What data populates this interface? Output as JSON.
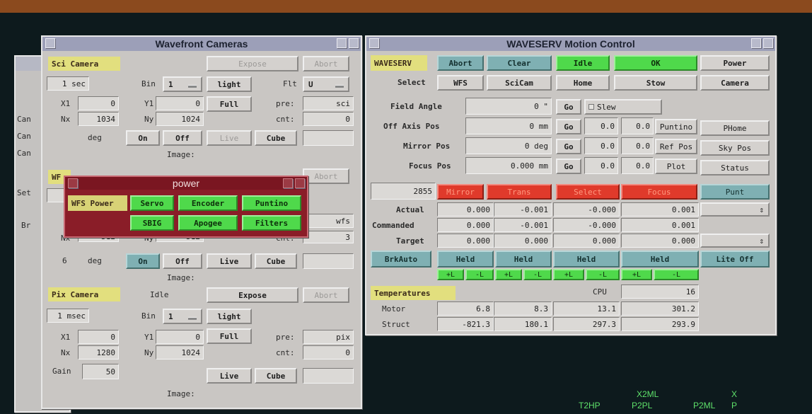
{
  "wavefront": {
    "title": "Wavefront Cameras",
    "sci": {
      "header": "Sci Camera",
      "exp_val": "1",
      "exp_unit": "sec",
      "bin_label": "Bin",
      "bin_val": "1",
      "light": "light",
      "flt_label": "Flt",
      "flt_val": "U",
      "expose": "Expose",
      "abort": "Abort",
      "x1_label": "X1",
      "x1": "0",
      "y1_label": "Y1",
      "y1": "0",
      "full": "Full",
      "pre_label": "pre:",
      "pre_val": "sci",
      "nx_label": "Nx",
      "nx": "1034",
      "ny_label": "Ny",
      "ny": "1024",
      "cnt_label": "cnt:",
      "cnt": "0",
      "deg": "deg",
      "on": "On",
      "off": "Off",
      "live": "Live",
      "cube": "Cube",
      "image": "Image:"
    },
    "wfs": {
      "header": "WF",
      "abort": "Abort",
      "pre_val": "wfs",
      "nx_label": "Nx",
      "nx": "512",
      "ny_label": "Ny",
      "ny": "512",
      "cnt_label": "cnt:",
      "cnt": "3",
      "deg_val": "6",
      "deg": "deg",
      "on": "On",
      "off": "Off",
      "live": "Live",
      "cube": "Cube",
      "image": "Image:"
    },
    "pix": {
      "header": "Pix Camera",
      "status": "Idle",
      "expose": "Expose",
      "abort": "Abort",
      "exp_val": "1",
      "exp_unit": "msec",
      "bin_label": "Bin",
      "bin_val": "1",
      "light": "light",
      "x1_label": "X1",
      "x1": "0",
      "y1_label": "Y1",
      "y1": "0",
      "full": "Full",
      "pre_label": "pre:",
      "pre_val": "pix",
      "nx_label": "Nx",
      "nx": "1280",
      "ny_label": "Ny",
      "ny": "1024",
      "cnt_label": "cnt:",
      "cnt": "0",
      "gain_label": "Gain",
      "gain": "50",
      "live": "Live",
      "cube": "Cube",
      "image": "Image:"
    },
    "back_side": [
      "Can",
      "Can",
      "Can",
      "Set",
      "Br"
    ]
  },
  "power": {
    "title": "power",
    "label": "WFS Power",
    "buttons": [
      "Servo",
      "Encoder",
      "Puntino",
      "SBIG",
      "Apogee",
      "Filters"
    ]
  },
  "motion": {
    "title": "WAVESERV Motion Control",
    "header": "WAVESERV",
    "abort": "Abort",
    "clear": "Clear",
    "idle": "Idle",
    "ok": "OK",
    "power": "Power",
    "select_label": "Select",
    "wfs": "WFS",
    "scicam": "SciCam",
    "home": "Home",
    "stow": "Stow",
    "camera": "Camera",
    "rows": [
      {
        "label": "Field Angle",
        "value": "0",
        "unit": "\"",
        "go": "Go",
        "slew": "Slew"
      },
      {
        "label": "Off Axis Pos",
        "value": "0",
        "unit": "mm",
        "go": "Go",
        "a": "0.0",
        "b": "0.0",
        "btn": "Puntino",
        "btn2": "PHome"
      },
      {
        "label": "Mirror Pos",
        "value": "0",
        "unit": "deg",
        "go": "Go",
        "a": "0.0",
        "b": "0.0",
        "btn": "Ref Pos",
        "btn2": "Sky Pos"
      },
      {
        "label": "Focus Pos",
        "value": "0.000",
        "unit": "mm",
        "go": "Go",
        "a": "0.0",
        "b": "0.0",
        "btn": "Plot",
        "btn2": "Status"
      }
    ],
    "counter": "2855",
    "axes": [
      "Mirror",
      "Trans",
      "Select",
      "Focus"
    ],
    "punt": "Punt",
    "actual_label": "Actual",
    "actual": [
      "0.000",
      "-0.001",
      "-0.000",
      "0.001"
    ],
    "commanded_label": "Commanded",
    "commanded": [
      "0.000",
      "-0.001",
      "-0.000",
      "0.001"
    ],
    "target_label": "Target",
    "target": [
      "0.000",
      "0.000",
      "0.000",
      "0.000"
    ],
    "brkauto": "BrkAuto",
    "held": "Held",
    "liteoff": "Lite Off",
    "plus": "+L",
    "minus": "-L",
    "temps": {
      "header": "Temperatures",
      "cpu_label": "CPU",
      "cpu": "16",
      "motor_label": "Motor",
      "motor": [
        "6.8",
        "8.3",
        "13.1",
        "301.2"
      ],
      "struct_label": "Struct",
      "struct": [
        "-821.3",
        "180.1",
        "297.3",
        "293.9"
      ]
    }
  },
  "terminal": {
    "row1": [
      "X2ML",
      "X"
    ],
    "row2": [
      "T2HP",
      "P2PL",
      "P2ML",
      "P"
    ]
  },
  "colors": {
    "desktop": "#0d1a1d",
    "panel": "#c9c6c3",
    "title": "#9c9fb8",
    "green": "#4fd94b",
    "teal": "#7fb0b3",
    "red": "#e03a2b",
    "yellow": "#e2df7e"
  }
}
